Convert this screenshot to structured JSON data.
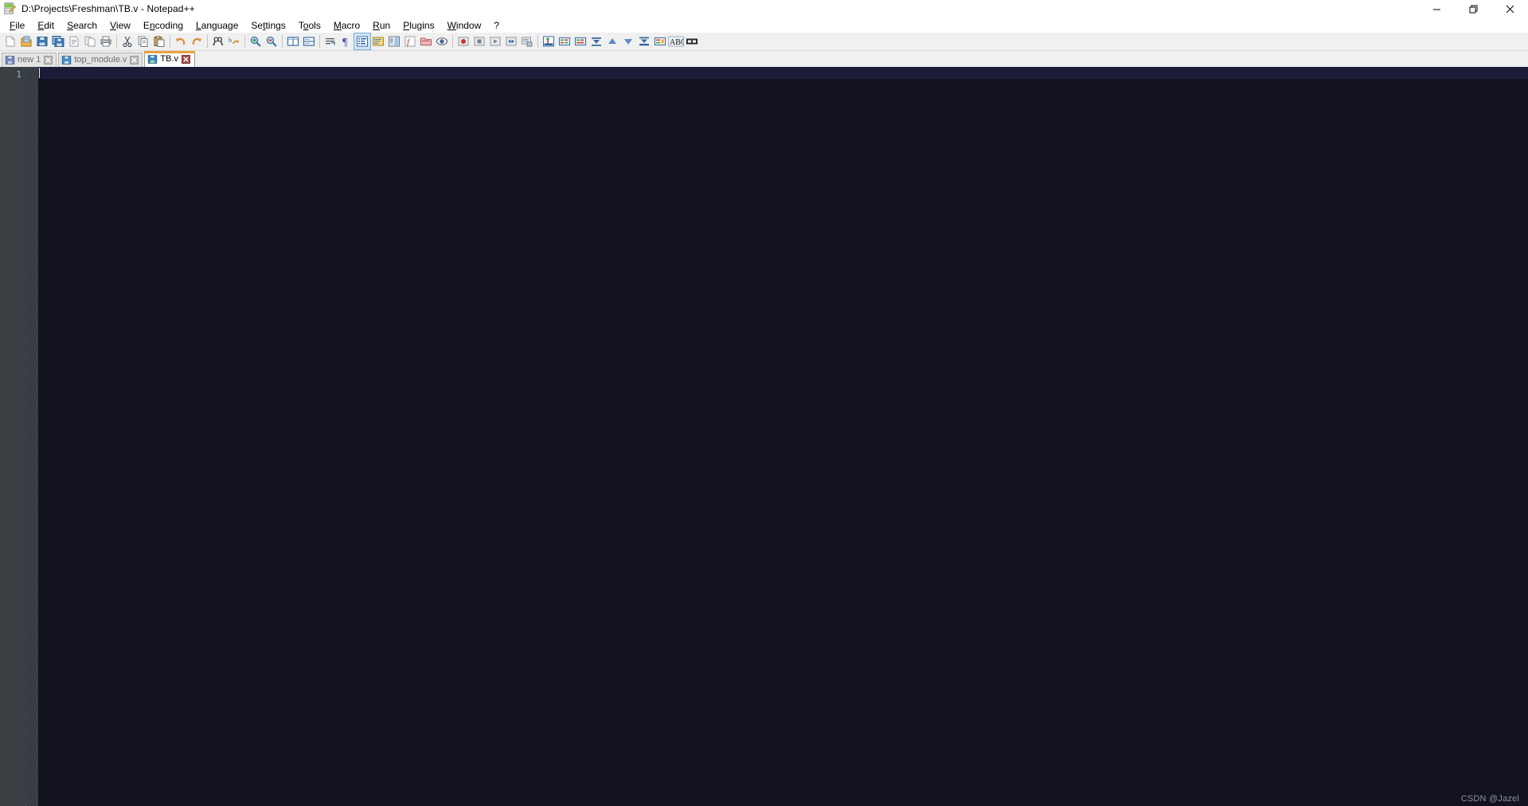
{
  "window": {
    "title": "D:\\Projects\\Freshman\\TB.v - Notepad++",
    "app_icon": "notepad-plus-plus-icon",
    "controls": {
      "minimize": "minimize-icon",
      "restore": "restore-icon",
      "close": "close-icon"
    }
  },
  "menubar": {
    "items": [
      {
        "label": "File",
        "accel": "F"
      },
      {
        "label": "Edit",
        "accel": "E"
      },
      {
        "label": "Search",
        "accel": "S"
      },
      {
        "label": "View",
        "accel": "V"
      },
      {
        "label": "Encoding",
        "accel": "n"
      },
      {
        "label": "Language",
        "accel": "L"
      },
      {
        "label": "Settings",
        "accel": "t"
      },
      {
        "label": "Tools",
        "accel": "o"
      },
      {
        "label": "Macro",
        "accel": "M"
      },
      {
        "label": "Run",
        "accel": "R"
      },
      {
        "label": "Plugins",
        "accel": "P"
      },
      {
        "label": "Window",
        "accel": "W"
      },
      {
        "label": "?",
        "accel": ""
      }
    ]
  },
  "toolbar": {
    "buttons": [
      {
        "name": "new-file-icon",
        "title": "New"
      },
      {
        "name": "open-file-icon",
        "title": "Open"
      },
      {
        "name": "save-icon",
        "title": "Save"
      },
      {
        "name": "save-all-icon",
        "title": "Save All"
      },
      {
        "name": "close-document-icon",
        "title": "Close"
      },
      {
        "name": "close-all-icon",
        "title": "Close All"
      },
      {
        "name": "print-icon",
        "title": "Print"
      },
      {
        "name": "separator",
        "title": ""
      },
      {
        "name": "cut-icon",
        "title": "Cut"
      },
      {
        "name": "copy-icon",
        "title": "Copy"
      },
      {
        "name": "paste-icon",
        "title": "Paste"
      },
      {
        "name": "separator",
        "title": ""
      },
      {
        "name": "undo-icon",
        "title": "Undo"
      },
      {
        "name": "redo-icon",
        "title": "Redo"
      },
      {
        "name": "separator",
        "title": ""
      },
      {
        "name": "find-icon",
        "title": "Find"
      },
      {
        "name": "replace-icon",
        "title": "Replace"
      },
      {
        "name": "separator",
        "title": ""
      },
      {
        "name": "zoom-in-icon",
        "title": "Zoom In"
      },
      {
        "name": "zoom-out-icon",
        "title": "Zoom Out"
      },
      {
        "name": "separator",
        "title": ""
      },
      {
        "name": "sync-vertical-scrolling-icon",
        "title": "Synchronize Vertical Scrolling"
      },
      {
        "name": "sync-horizontal-scrolling-icon",
        "title": "Synchronize Horizontal Scrolling"
      },
      {
        "name": "separator",
        "title": ""
      },
      {
        "name": "word-wrap-icon",
        "title": "Word wrap"
      },
      {
        "name": "show-all-characters-icon",
        "title": "Show All Characters"
      },
      {
        "name": "show-indent-guide-icon",
        "title": "Show Indent Guide"
      },
      {
        "name": "user-defined-dialog-icon",
        "title": "Show UDL dialog"
      },
      {
        "name": "document-map-icon",
        "title": "Document Map"
      },
      {
        "name": "function-list-icon",
        "title": "Function List"
      },
      {
        "name": "folder-workspace-icon",
        "title": "Folder as Workspace"
      },
      {
        "name": "monitoring-icon",
        "title": "Monitoring"
      },
      {
        "name": "separator",
        "title": ""
      },
      {
        "name": "macro-record-icon",
        "title": "Start Recording"
      },
      {
        "name": "macro-stop-icon",
        "title": "Stop Recording"
      },
      {
        "name": "macro-play-icon",
        "title": "Playback"
      },
      {
        "name": "macro-multiplay-icon",
        "title": "Run a Macro Multiple Times"
      },
      {
        "name": "macro-save-icon",
        "title": "Save Currently Recorded Macro"
      },
      {
        "name": "separator",
        "title": ""
      },
      {
        "name": "run-icon",
        "title": "Run a program"
      },
      {
        "name": "bookmark-toggle-icon",
        "title": "Toggle Bookmark"
      },
      {
        "name": "bookmark-clear-icon",
        "title": "Clear all Bookmarks"
      },
      {
        "name": "bookmark-next-icon",
        "title": "Next Bookmark"
      },
      {
        "name": "bookmark-prev-up-icon",
        "title": "Previous Bookmark"
      },
      {
        "name": "bookmark-prev-icon",
        "title": "Previous Bookmark"
      },
      {
        "name": "bookmark-cut-icon",
        "title": "Cut Bookmarked Lines"
      },
      {
        "name": "bookmark-copy-icon",
        "title": "Copy Bookmarked Lines"
      },
      {
        "name": "spellcheck-icon",
        "title": "ABC - Spell Check"
      },
      {
        "name": "fullscreen-icon",
        "title": "Toggle Full Screen Mode"
      }
    ]
  },
  "tabs": [
    {
      "label": "new 1",
      "icon": "save-document-icon",
      "active": false,
      "close": "close-tab-icon"
    },
    {
      "label": "top_module.v",
      "icon": "save-document-icon",
      "active": false,
      "close": "close-tab-icon"
    },
    {
      "label": "TB.v",
      "icon": "save-document-icon",
      "active": true,
      "close": "close-tab-icon"
    }
  ],
  "editor": {
    "line_numbers": [
      "1"
    ],
    "lines": [
      ""
    ],
    "colors": {
      "background": "#12121f",
      "current_line": "#1c1c38",
      "gutter_background": "#3a3f44",
      "line_number_color": "#9bb6d1",
      "caret": "#e8e8e8",
      "active_tab_accent": "#e5a33c"
    }
  },
  "watermark": {
    "text": "CSDN @Jazel"
  }
}
